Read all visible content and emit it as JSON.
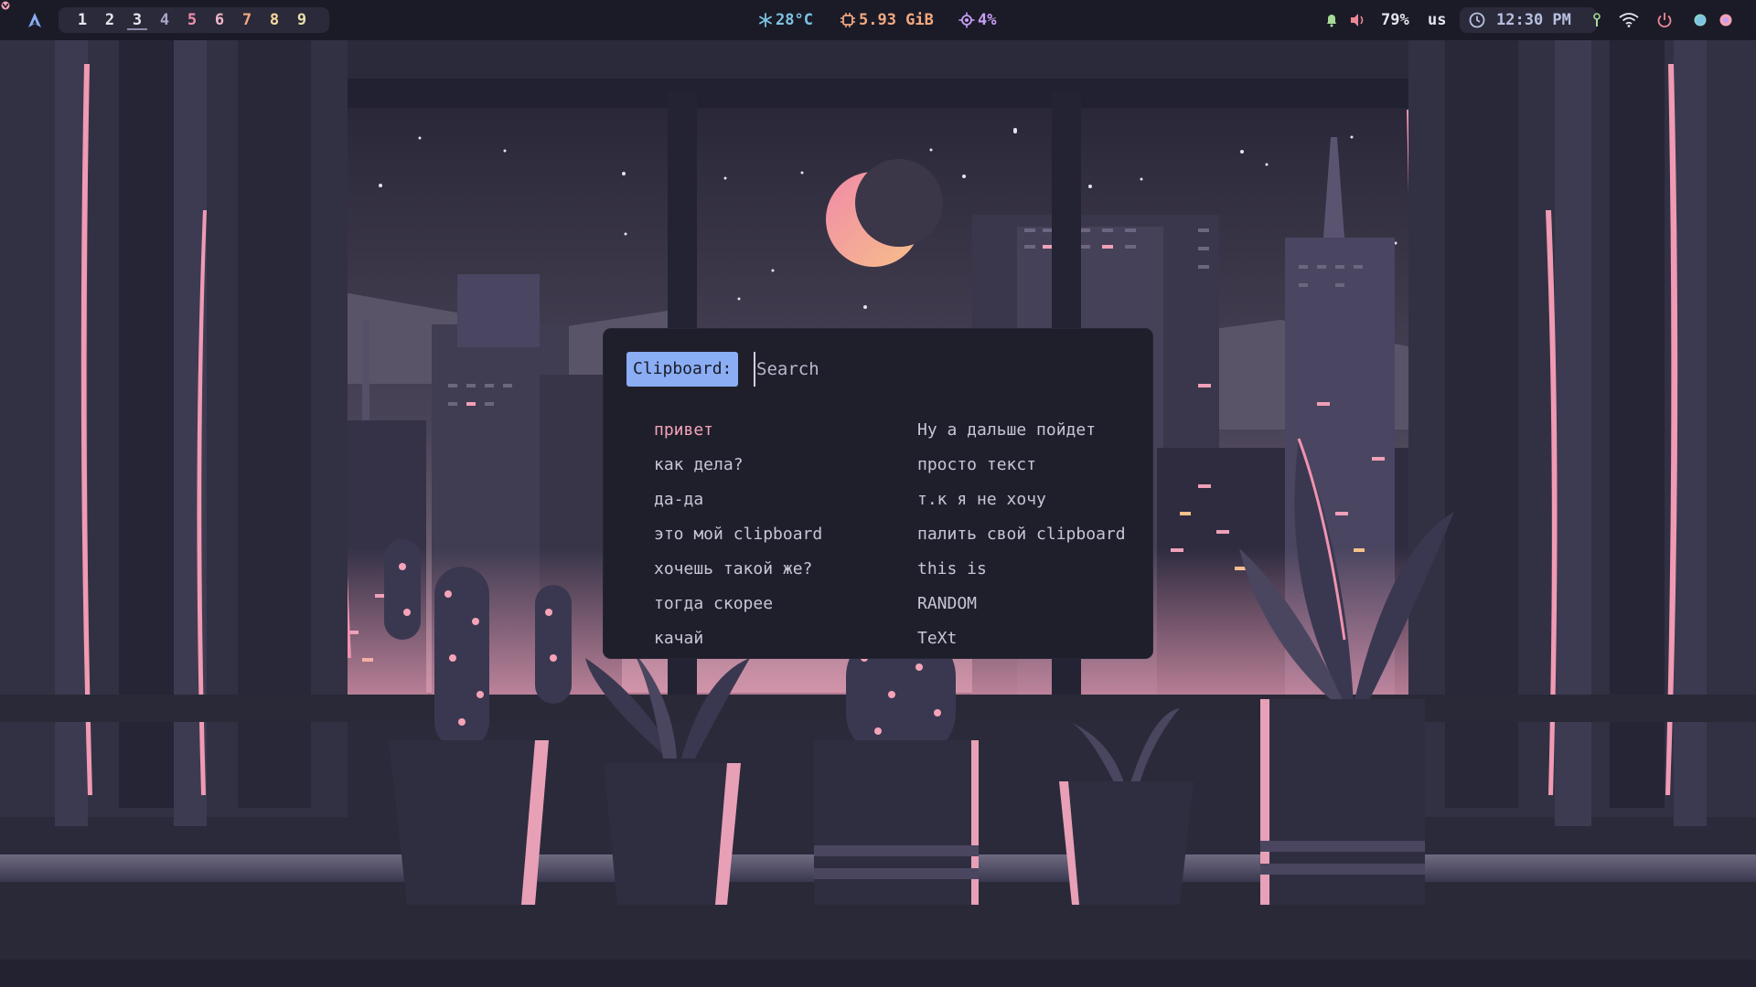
{
  "topbar": {
    "workspaces": [
      {
        "label": "1",
        "color": "#e6e6ee",
        "active": false
      },
      {
        "label": "2",
        "color": "#e6e6ee",
        "active": false
      },
      {
        "label": "3",
        "color": "#e6e6ee",
        "active": true
      },
      {
        "label": "4",
        "color": "#a8a7c8",
        "active": false
      },
      {
        "label": "5",
        "color": "#f28fad",
        "active": false
      },
      {
        "label": "6",
        "color": "#f0b7c9",
        "active": false
      },
      {
        "label": "7",
        "color": "#f5a97f",
        "active": false
      },
      {
        "label": "8",
        "color": "#f7d9a0",
        "active": false
      },
      {
        "label": "9",
        "color": "#e6e2a8",
        "active": false
      }
    ],
    "temperature": {
      "icon": "snowflake-icon",
      "value": "28°C",
      "color": "#7dc4e4"
    },
    "memory": {
      "icon": "chip-icon",
      "value": "5.93 GiB",
      "color": "#f5a97f"
    },
    "cpu": {
      "icon": "cpu-icon",
      "value": "4%",
      "color": "#c6a0f6"
    },
    "volume": {
      "icon": "speaker-icon",
      "value": "79%",
      "color": "#e6e6ee"
    },
    "keyboard_layout": {
      "value": "us",
      "color": "#e6e6ee"
    },
    "clock": {
      "icon": "clock-icon",
      "value": "12:30 PM",
      "color": "#b8c0e0"
    },
    "status_icons": [
      "notification-bell-icon",
      "speaker-icon",
      "lock-icon",
      "wifi-icon",
      "power-icon",
      "firefox-icon",
      "color-picker-icon"
    ],
    "colors": {
      "bar_bg": "#1b1b28",
      "pill_bg": "#2a2a3a",
      "notify": "#a6da95",
      "volume": "#ed8796",
      "power": "#ed8796"
    }
  },
  "launcher": {
    "prompt": "Clipboard:",
    "placeholder": "Search",
    "entries_left": [
      "привет",
      "как дела?",
      "да-да",
      "это мой clipboard",
      "хочешь такой же?",
      "тогда скорее",
      "качай"
    ],
    "entries_right": [
      "Ну а дальше пойдет",
      "просто текст",
      "т.к я не хочу",
      "палить свой clipboard",
      "this is",
      "RANDOM",
      "TeXt"
    ],
    "selected_index": 0,
    "colors": {
      "bg": "#1f1f2c",
      "prompt_bg": "#8aadf4",
      "text": "#c6c7d6",
      "selected": "#f5a3b8"
    }
  }
}
